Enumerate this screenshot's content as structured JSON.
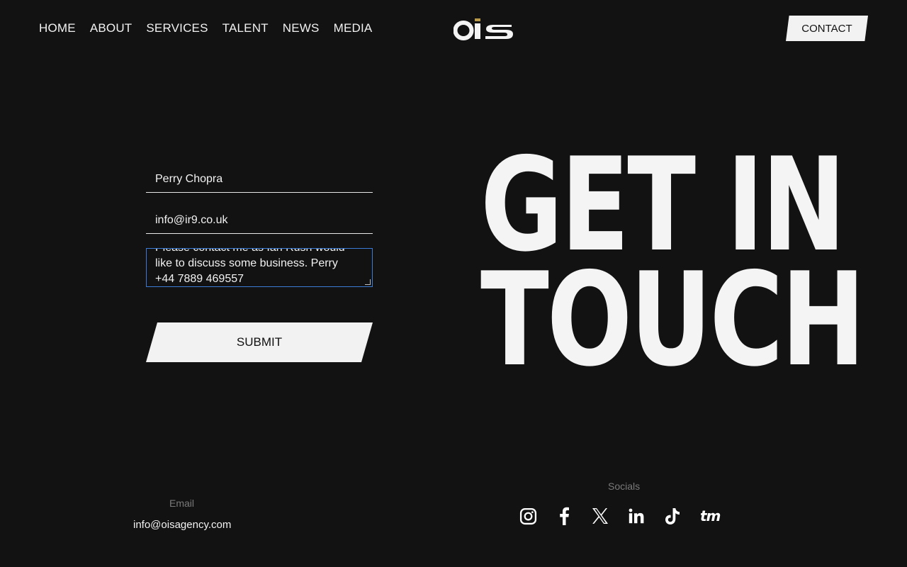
{
  "nav": {
    "items": [
      "HOME",
      "ABOUT",
      "SERVICES",
      "TALENT",
      "NEWS",
      "MEDIA"
    ]
  },
  "logo": {
    "text": "OIS"
  },
  "header": {
    "contact_label": "CONTACT"
  },
  "form": {
    "name_value": "Perry Chopra",
    "email_value": "info@ir9.co.uk",
    "message_lines": [
      "Please contact me as Ian Rush would",
      "like to discuss some business.  Perry",
      "+44 7889 469557"
    ],
    "submit_label": "SUBMIT"
  },
  "headline": {
    "line1": "GET IN",
    "line2": "TOUCH"
  },
  "footer": {
    "email_label": "Email",
    "email_value": "info@oisagency.com",
    "socials_label": "Socials",
    "socials": [
      "instagram-icon",
      "facebook-icon",
      "x-icon",
      "linkedin-icon",
      "tiktok-icon",
      "tm-icon"
    ]
  },
  "colors": {
    "background": "#121212",
    "text": "#f2f2f2",
    "focus_border": "#3b7bd6",
    "logo_accent": "#b89a4a"
  }
}
